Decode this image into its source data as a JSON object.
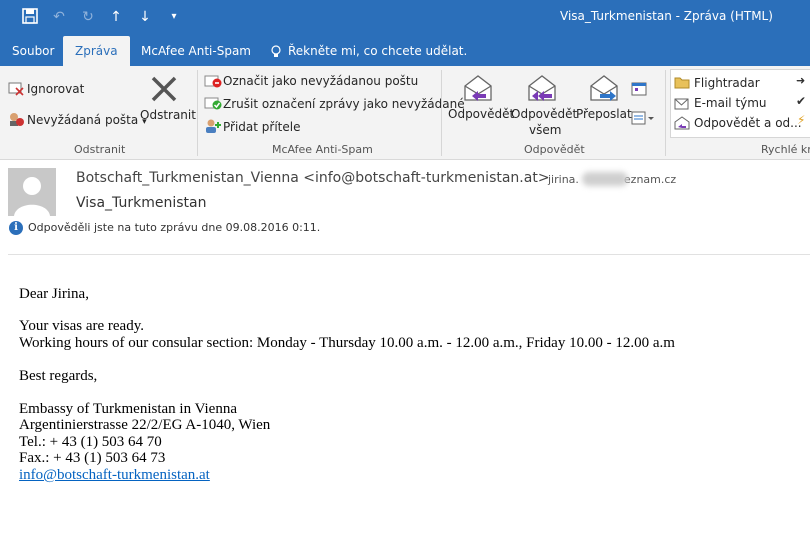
{
  "window": {
    "title": "Visa_Turkmenistan - Zpráva (HTML)"
  },
  "tabs": [
    "Soubor",
    "Zpráva",
    "McAfee Anti-Spam",
    "Řekněte mi, co chcete udělat."
  ],
  "ribbon": {
    "delete_group": {
      "ignore": "Ignorovat",
      "junk": "Nevyžádaná pošta",
      "delete": "Odstranit",
      "label": "Odstranit"
    },
    "mcafee_group": {
      "mark_spam": "Označit jako nevyžádanou poštu",
      "unmark_spam": "Zrušit označení zprávy jako nevyžádané",
      "add_friend": "Přidat přítele",
      "label": "McAfee Anti-Spam"
    },
    "respond_group": {
      "reply": "Odpovědět",
      "reply_all_line1": "Odpovědět",
      "reply_all_line2": "všem",
      "forward": "Přeposlat",
      "label": "Odpovědět"
    },
    "quick_steps": {
      "items": [
        "Flightradar",
        "E-mail týmu",
        "Odpovědět a od..."
      ],
      "label": "Rychlé kro"
    }
  },
  "message": {
    "from": "Botschaft_Turkmenistan_Vienna <info@botschaft-turkmenistan.at>",
    "to_prefix": "jirina.",
    "to_suffix": "eznam.cz",
    "subject": "Visa_Turkmenistan",
    "info": "Odpověděli jste na tuto zprávu dne 09.08.2016 0:11."
  },
  "body": {
    "greeting": "Dear Jirina,",
    "line1": "Your visas are ready.",
    "line2": "Working hours of our consular section:  Monday - Thursday 10.00 a.m. - 12.00 a.m., Friday 10.00 - 12.00 a.m",
    "closing": "Best regards,",
    "sig_name": "Embassy of Turkmenistan in Vienna",
    "sig_address": "Argentinierstrasse 22/2/EG A-1040, Wien",
    "sig_tel": "Tel.: + 43 (1) 503 64 70",
    "sig_fax": "Fax.: + 43 (1) 503 64 73",
    "sig_email": "info@botschaft-turkmenistan.at"
  }
}
